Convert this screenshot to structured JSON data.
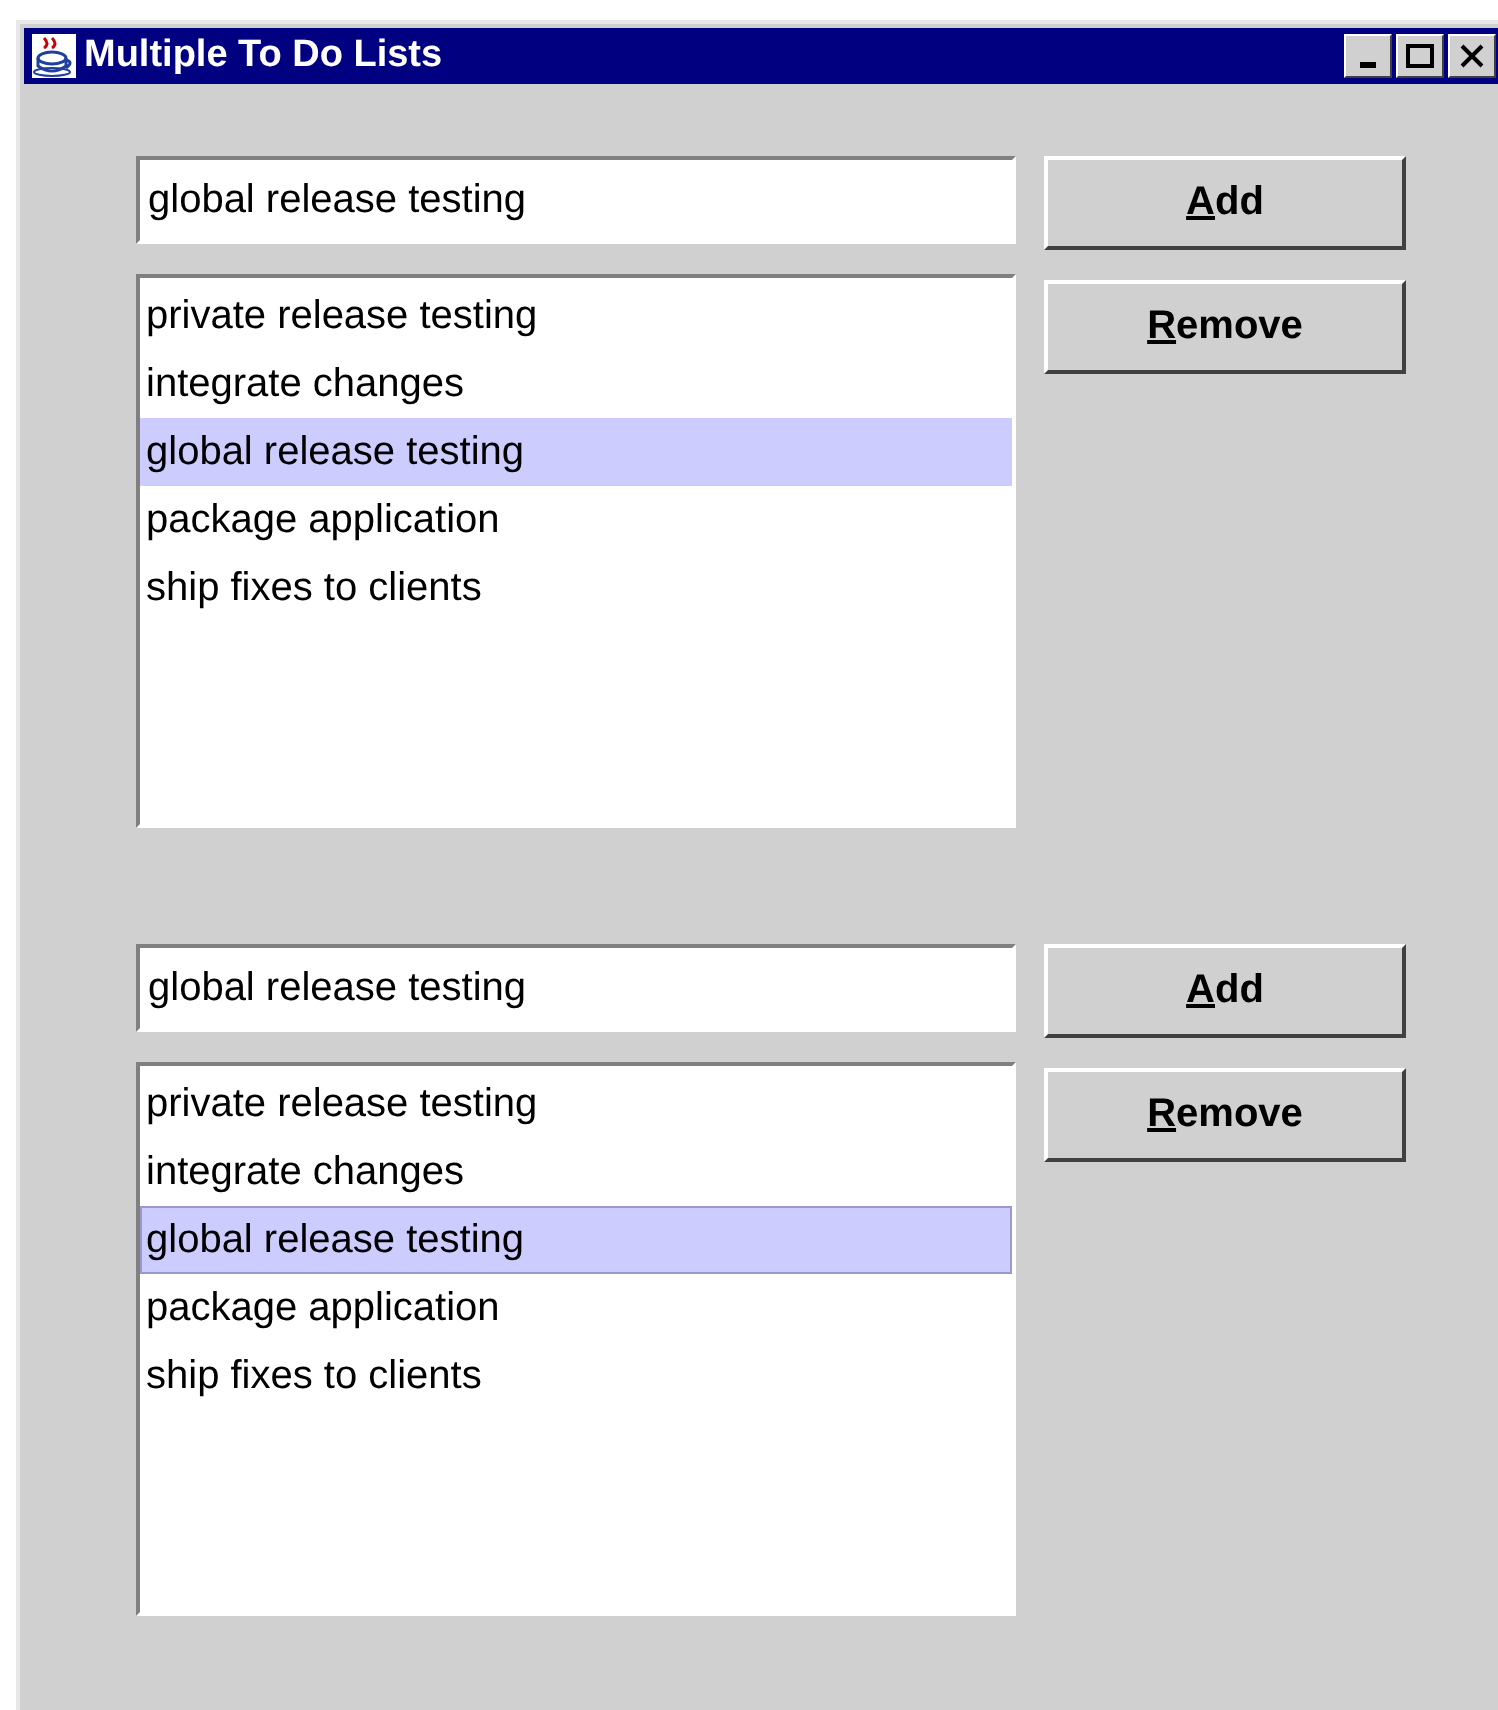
{
  "window": {
    "title": "Multiple To Do Lists"
  },
  "title_buttons": [
    {
      "kind": "minimize"
    },
    {
      "kind": "maximize"
    },
    {
      "kind": "close"
    }
  ],
  "panels": [
    {
      "input": {
        "value": "global release testing"
      },
      "buttons": [
        {
          "label": "Add",
          "mnemonic_first_letter": true
        },
        {
          "label": "Remove",
          "mnemonic_first_letter": true
        }
      ],
      "list": {
        "focused": false,
        "items": [
          {
            "label": "private release testing",
            "selected": false
          },
          {
            "label": "integrate changes",
            "selected": false
          },
          {
            "label": "global release testing",
            "selected": true
          },
          {
            "label": "package application",
            "selected": false
          },
          {
            "label": "ship fixes to clients",
            "selected": false
          }
        ]
      }
    },
    {
      "input": {
        "value": "global release testing"
      },
      "buttons": [
        {
          "label": "Add",
          "mnemonic_first_letter": true
        },
        {
          "label": "Remove",
          "mnemonic_first_letter": true
        }
      ],
      "list": {
        "focused": true,
        "items": [
          {
            "label": "private release testing",
            "selected": false
          },
          {
            "label": "integrate changes",
            "selected": false
          },
          {
            "label": "global release testing",
            "selected": true
          },
          {
            "label": "package application",
            "selected": false
          },
          {
            "label": "ship fixes to clients",
            "selected": false
          }
        ]
      }
    }
  ]
}
